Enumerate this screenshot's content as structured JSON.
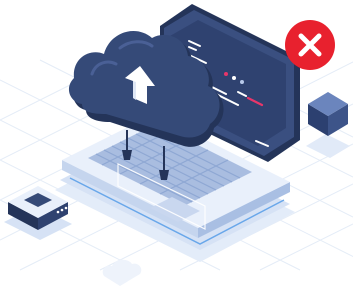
{
  "illustration": {
    "subject": "cloud-upload-laptop",
    "icons": [
      "cloud-icon",
      "upload-arrow-icon",
      "laptop-icon",
      "server-cube-icon",
      "router-box-icon",
      "error-x-icon"
    ],
    "colors": {
      "navy": "#354a78",
      "navy_dark": "#243459",
      "navy_light": "#4a6096",
      "screen": "#2f4270",
      "keyboard": "#a9bde0",
      "base_light": "#d6e2f5",
      "outline_blue": "#69a7ea",
      "grid_line": "#e4ecf7",
      "error_red": "#e8212e",
      "white": "#ffffff",
      "accent_pink": "#e8366a",
      "accent_lightblue": "#b8c9ea"
    }
  },
  "status": {
    "state": "error",
    "icon": "error-x-icon"
  }
}
